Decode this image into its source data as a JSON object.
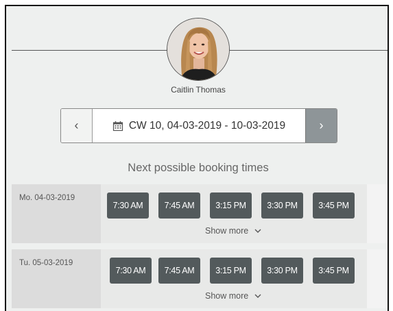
{
  "profile": {
    "name": "Caitlin Thomas"
  },
  "week_nav": {
    "prev_symbol": "‹",
    "next_symbol": "›",
    "label": "CW 10, 04-03-2019 - 10-03-2019"
  },
  "section_title": "Next possible booking times",
  "days": [
    {
      "label": "Mo. 04-03-2019",
      "slots": [
        "7:30 AM",
        "7:45 AM",
        "3:15 PM",
        "3:30 PM",
        "3:45 PM"
      ],
      "show_more": "Show more"
    },
    {
      "label": "Tu. 05-03-2019",
      "slots": [
        "7:30 AM",
        "7:45 AM",
        "3:15 PM",
        "3:30 PM",
        "3:45 PM"
      ],
      "show_more": "Show more"
    }
  ],
  "colors": {
    "slot_button": "#535a5c",
    "next_button": "#8e9598",
    "panel_background": "#eef0ef"
  },
  "icons": {
    "calendar": "calendar-icon",
    "chevron": "chevron-down-icon"
  }
}
